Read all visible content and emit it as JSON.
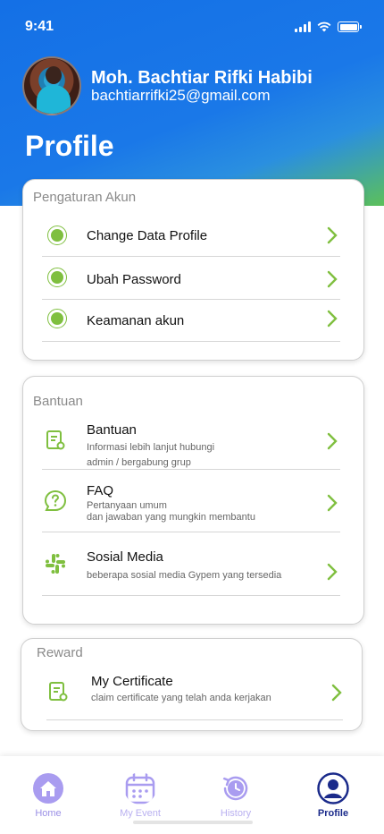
{
  "status_bar": {
    "time": "9:41"
  },
  "user": {
    "name": "Moh. Bachtiar Rifki Habibi",
    "email": "bachtiarrifki25@gmail.com"
  },
  "page_title": "Profile",
  "account_settings": {
    "title": "Pengaturan Akun",
    "items": [
      {
        "label": "Change Data Profile"
      },
      {
        "label": "Ubah Password"
      },
      {
        "label": "Keamanan akun"
      }
    ]
  },
  "help": {
    "title": "Bantuan",
    "items": [
      {
        "label": "Bantuan",
        "sub1": "Informasi lebih lanjut hubungi",
        "sub2": "admin / bergabung  grup"
      },
      {
        "label": "FAQ",
        "sub1": "Pertanyaan umum",
        "sub2": "dan jawaban yang mungkin membantu"
      },
      {
        "label": "Sosial Media",
        "sub1": "beberapa sosial media Gypem yang tersedia"
      }
    ]
  },
  "reward": {
    "title": "Reward",
    "items": [
      {
        "label": "My Certificate",
        "sub1": "claim  certificate yang telah anda kerjakan"
      }
    ]
  },
  "bottom_nav": [
    {
      "label": "Home",
      "icon": "home-icon"
    },
    {
      "label": "My Event",
      "icon": "calendar-icon"
    },
    {
      "label": "History",
      "icon": "history-icon"
    },
    {
      "label": "Profile",
      "icon": "user-icon",
      "active": true
    }
  ],
  "colors": {
    "accent_green": "#7fbf3f",
    "nav_purple": "#9a8fe6",
    "nav_active": "#1a2a8a",
    "header_blue": "#1470e6"
  }
}
